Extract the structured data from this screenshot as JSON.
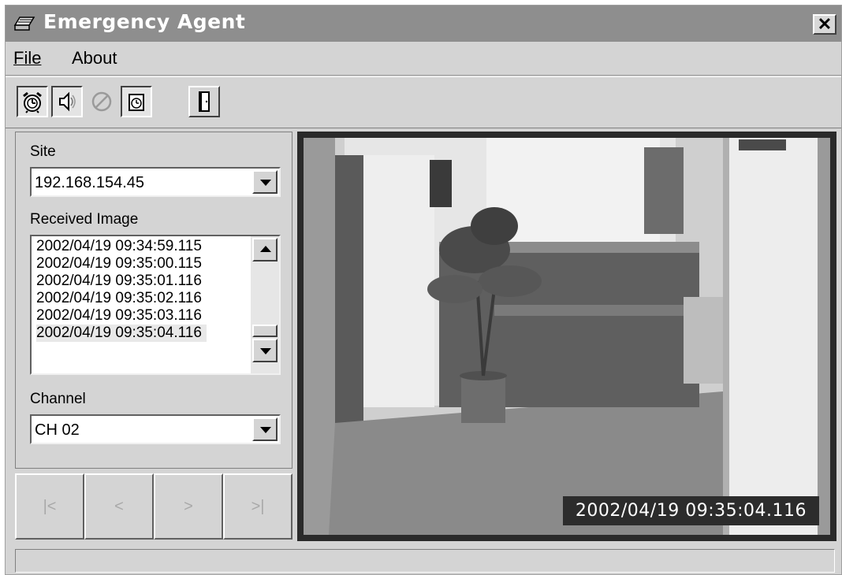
{
  "window": {
    "title": "Emergency Agent",
    "close_glyph": "✕"
  },
  "menu": {
    "file": "File",
    "about": "About"
  },
  "toolbar": {
    "buttons": [
      {
        "icon": "alarm-clock-icon",
        "state": "pressed"
      },
      {
        "icon": "speaker-icon",
        "state": "pressed"
      },
      {
        "icon": "no-entry-icon",
        "state": "disabled"
      },
      {
        "icon": "schedule-icon",
        "state": "pressed"
      },
      {
        "icon": "exit-door-icon",
        "state": "raised"
      }
    ]
  },
  "left_panel": {
    "site_label": "Site",
    "site_value": "192.168.154.45",
    "received_label": "Received Image",
    "received_items": [
      "2002/04/19 09:34:59.115",
      "2002/04/19 09:35:00.115",
      "2002/04/19 09:35:01.116",
      "2002/04/19 09:35:02.116",
      "2002/04/19 09:35:03.116",
      "2002/04/19 09:35:04.116"
    ],
    "channel_label": "Channel",
    "channel_value": "CH 02"
  },
  "nav": {
    "first": "|<",
    "prev": "<",
    "next": ">",
    "last": ">|"
  },
  "video": {
    "timestamp": "2002/04/19 09:35:04.116"
  },
  "colors": {
    "titlebar": "#8e8e8e",
    "window_bg": "#d4d4d4"
  }
}
